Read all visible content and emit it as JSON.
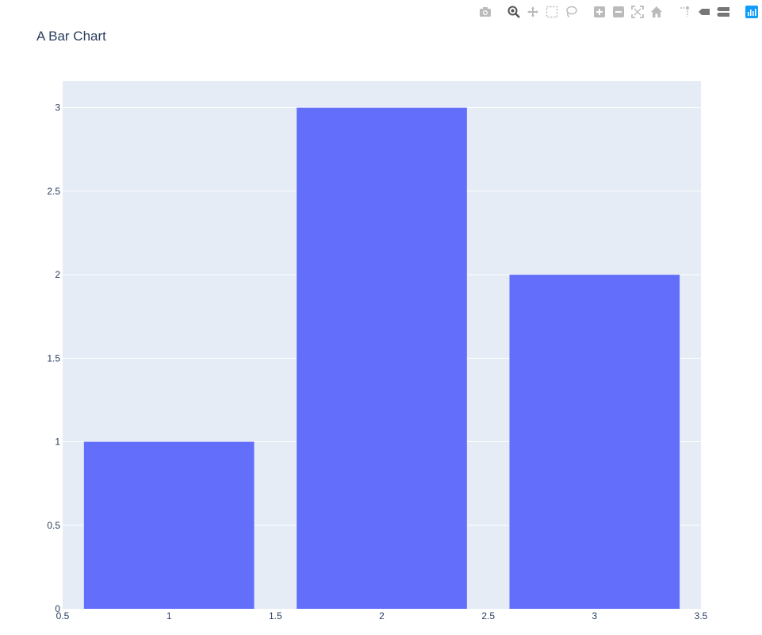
{
  "chart_data": {
    "type": "bar",
    "title": "A Bar Chart",
    "x": [
      1,
      2,
      3
    ],
    "values": [
      1,
      3,
      2
    ],
    "bar_width": 0.8,
    "xlim": [
      0.5,
      3.5
    ],
    "ylim": [
      0,
      3.16
    ],
    "xticks": [
      "0.5",
      "1",
      "1.5",
      "2",
      "2.5",
      "3",
      "3.5"
    ],
    "xtick_values": [
      0.5,
      1,
      1.5,
      2,
      2.5,
      3,
      3.5
    ],
    "yticks": [
      "0",
      "0.5",
      "1",
      "1.5",
      "2",
      "2.5",
      "3"
    ],
    "ytick_values": [
      0,
      0.5,
      1,
      1.5,
      2,
      2.5,
      3
    ],
    "xlabel": "",
    "ylabel": "",
    "grid": true,
    "colors": {
      "bar": "#636efa",
      "plot_bg": "#e5ecf6",
      "grid": "#ffffff",
      "text": "#2a3f5f"
    }
  },
  "modebar": {
    "icons": [
      "camera-icon",
      "zoom-icon",
      "pan-icon",
      "box-select-icon",
      "lasso-icon",
      "zoom-in-icon",
      "zoom-out-icon",
      "autoscale-icon",
      "reset-axes-icon",
      "spike-lines-icon",
      "hover-closest-icon",
      "hover-compare-icon",
      "plotly-logo-icon"
    ]
  }
}
